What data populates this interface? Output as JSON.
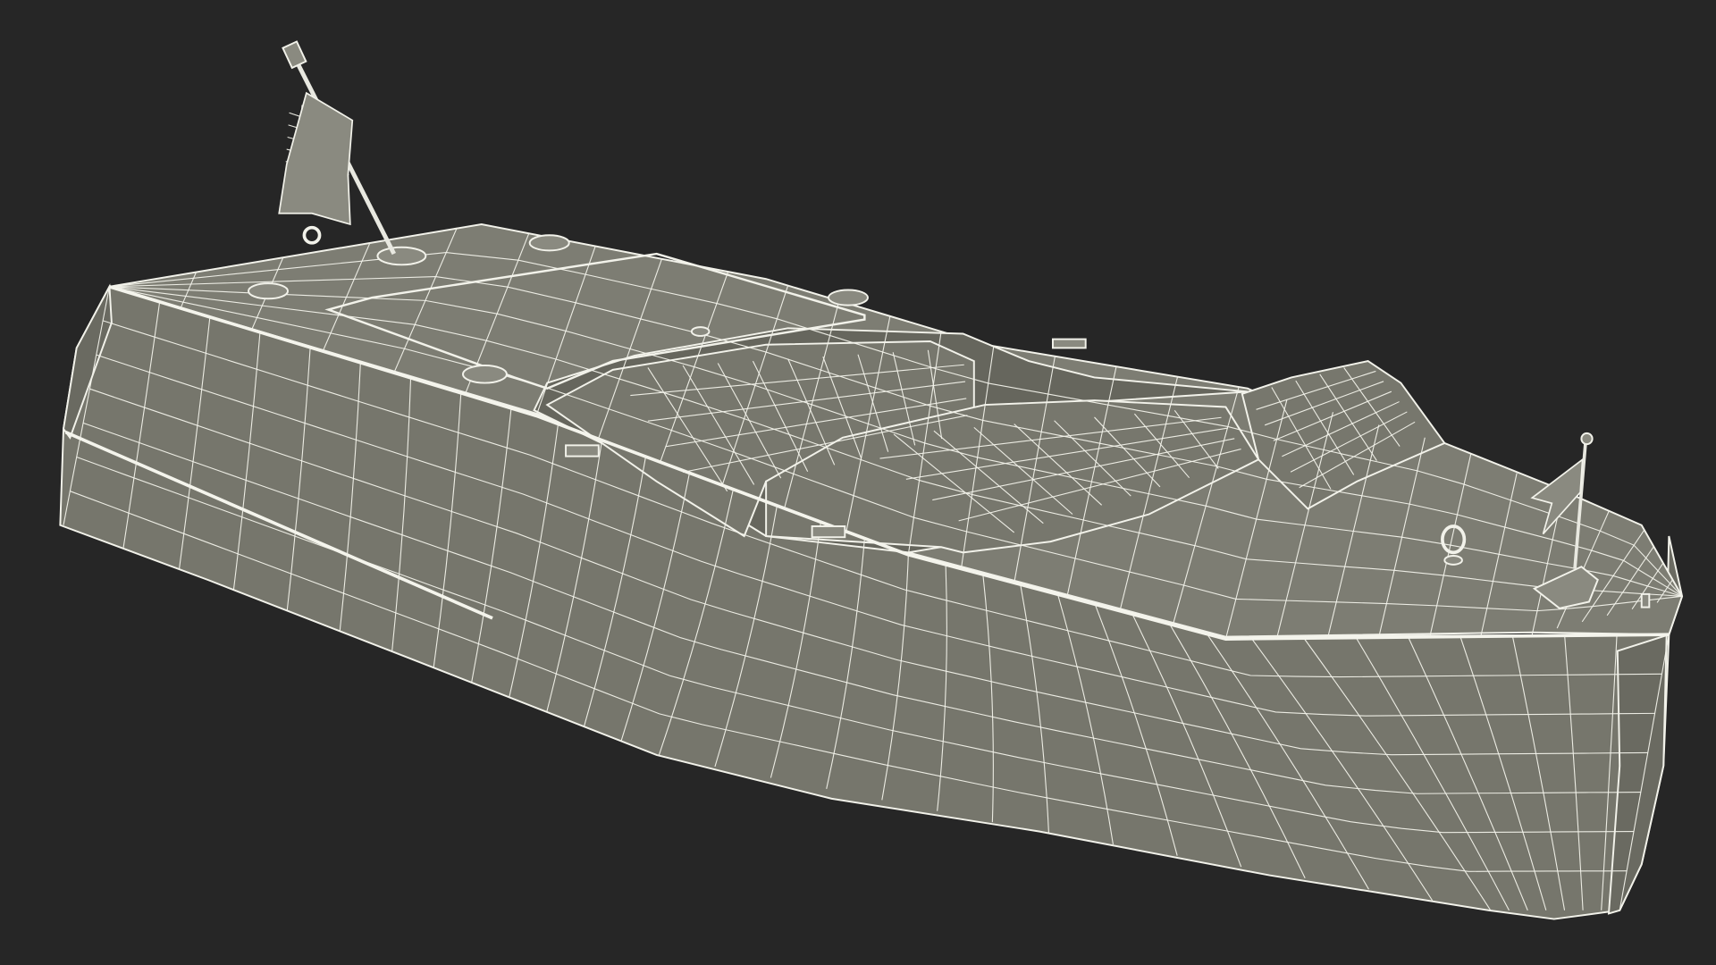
{
  "scene": {
    "subject": "boat-wireframe-model",
    "render_mode": "wireframe-on-shaded",
    "colors": {
      "background": "#262626",
      "hull": "#76766c",
      "hull_dark": "#6a6a61",
      "deck": "#7d7d73",
      "cockpit": "#66665d",
      "wire": "#f2f2ea",
      "edge": "#e8e8e0"
    }
  }
}
